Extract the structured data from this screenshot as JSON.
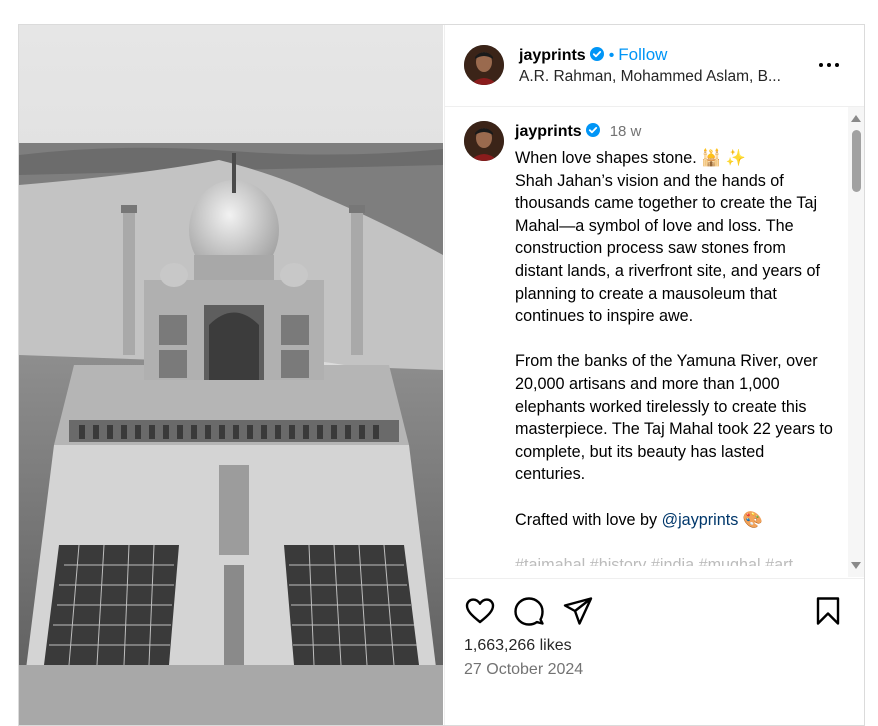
{
  "post": {
    "image_alt": "Black and white aerial view of the Taj Mahal under construction with scaffolding"
  },
  "header": {
    "username": "jayprints",
    "separator": "•",
    "follow_label": "Follow",
    "subtitle": "A.R. Rahman, Mohammed Aslam, B...",
    "more_icon": "more-horizontal-icon"
  },
  "comment": {
    "username": "jayprints",
    "time": "18 w",
    "paragraph1": [
      "When love shapes stone. 🕌 ✨",
      "Shah Jahan’s vision and the hands of thousands came together to create the Taj Mahal—a symbol of love and loss. The construction process saw stones from distant lands, a riverfront site, and years of planning to create a mausoleum that continues to inspire awe."
    ],
    "paragraph2": "From the banks of the Yamuna River, over 20,000 artisans and more than 1,000 elephants worked tirelessly to create this masterpiece. The Taj Mahal took 22 years to complete, but its beauty has lasted centuries.",
    "paragraph3_prefix": "Crafted with love by ",
    "paragraph3_mention": "@jayprints",
    "paragraph3_suffix": " 🎨",
    "hashtags_faded": "#tajmahal #history #india #mughal #art"
  },
  "actions": {
    "likes": "1,663,266 likes",
    "date": "27 October 2024"
  },
  "colors": {
    "accent": "#0095f6",
    "verified": "#0095f6",
    "secondary_text": "#737373",
    "border": "#dbdbdb"
  }
}
